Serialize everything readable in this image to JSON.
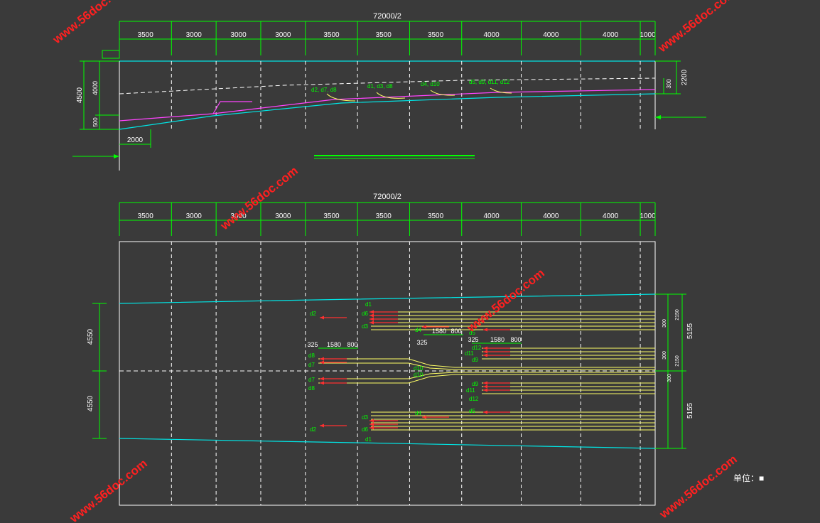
{
  "colors": {
    "background": "#3a3a3a",
    "frame": "#ffffff",
    "dimension": "#00ff00",
    "dimension_text": "#ffffff",
    "label": "#00ff00",
    "boundary": "#00e5e5",
    "tendon": "#ffff66",
    "anchor": "#ff3030",
    "profile": "#ff44ff",
    "watermark": "#ff2020"
  },
  "elevation": {
    "total_dimension": "72000/2",
    "segments": [
      "3500",
      "3000",
      "3000",
      "3000",
      "3500",
      "3500",
      "3500",
      "4000",
      "4000",
      "4000",
      "1000"
    ],
    "left_dims": {
      "total": "4500",
      "upper": "4000",
      "lower": "500"
    },
    "right_dims": {
      "total": "2200",
      "small": "300"
    },
    "bottom_dim": "2000",
    "anchor_labels": [
      "d2, d7, d8",
      "d1, d3, d8",
      "d4, d10",
      "d5, d9, d11, d12"
    ]
  },
  "plan": {
    "total_dimension": "72000/2",
    "segments": [
      "3500",
      "3000",
      "3000",
      "3000",
      "3500",
      "3500",
      "3500",
      "4000",
      "4000",
      "4000",
      "1000"
    ],
    "left_dims": {
      "upper": "4550",
      "lower": "4550"
    },
    "right_dims": {
      "upper": "5155",
      "lower": "5155",
      "small_a": "2150",
      "small_b": "300",
      "small_c": "2150",
      "small_d": "300",
      "small_e": "300"
    },
    "detail_dims": {
      "a": "325",
      "b": "1580",
      "c": "800",
      "d": "325",
      "e": "1580",
      "f": "800",
      "g": "325",
      "h": "1580",
      "i": "800"
    },
    "tendon_labels": {
      "top_group": [
        "d1",
        "d2",
        "d6",
        "d3"
      ],
      "d4_top": "d4",
      "mid_left": [
        "d8",
        "d7",
        "d7",
        "d8"
      ],
      "mid_center": [
        "d10",
        "d10"
      ],
      "right_upper": [
        "d12",
        "d11",
        "d9"
      ],
      "right_lower": [
        "d9",
        "d11",
        "d12"
      ],
      "bottom_group": [
        "d3",
        "d2",
        "d6",
        "d1"
      ],
      "d4_bottom": "d4",
      "d5_top": "d5",
      "d5_bottom": "d5"
    }
  },
  "unit_label": "单位：",
  "unit_value": "■",
  "watermark": "www.56doc.com"
}
